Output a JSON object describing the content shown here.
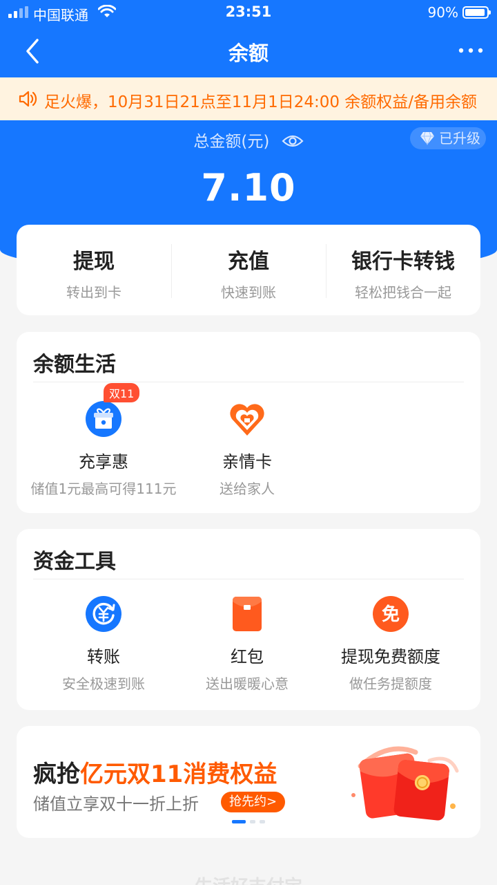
{
  "status_bar": {
    "carrier": "中国联通",
    "time": "23:51",
    "battery_percent": "90%",
    "battery_level": 0.9
  },
  "nav": {
    "title": "余额",
    "back_icon": "chevron-left-icon",
    "more_icon": "more-dots-icon"
  },
  "notice": {
    "text": "足火爆，10月31日21点至11月1日24:00 余额权益/备用余额"
  },
  "balance": {
    "label": "总金额(元)",
    "amount": "7.10",
    "upgrade_badge": "已升级"
  },
  "actions": [
    {
      "title": "提现",
      "subtitle": "转出到卡"
    },
    {
      "title": "充值",
      "subtitle": "快速到账"
    },
    {
      "title": "银行卡转钱",
      "subtitle": "轻松把钱合一起"
    }
  ],
  "life_section": {
    "title": "余额生活",
    "items": [
      {
        "name": "充享惠",
        "desc": "储值1元最高可得111元",
        "badge": "双11",
        "icon": "gift-icon"
      },
      {
        "name": "亲情卡",
        "desc": "送给家人",
        "icon": "heart-card-icon"
      }
    ]
  },
  "tools_section": {
    "title": "资金工具",
    "items": [
      {
        "name": "转账",
        "desc": "安全极速到账",
        "icon": "transfer-yuan-icon"
      },
      {
        "name": "红包",
        "desc": "送出暖暖心意",
        "icon": "red-envelope-icon"
      },
      {
        "name": "提现免费额度",
        "desc": "做任务提额度",
        "icon": "free-icon",
        "icon_text": "免"
      }
    ]
  },
  "banner": {
    "title_prefix": "疯抢",
    "title_highlight": "亿元双11消费权益",
    "subtitle": "储值立享双十一折上折",
    "button": "抢先约>",
    "image": "red-envelope-illustration"
  },
  "footer_text": "生活好支付宝",
  "colors": {
    "primary_blue": "#1677ff",
    "accent_orange": "#ff5a00",
    "notice_bg": "#fff3e0",
    "background": "#f5f5f5"
  }
}
